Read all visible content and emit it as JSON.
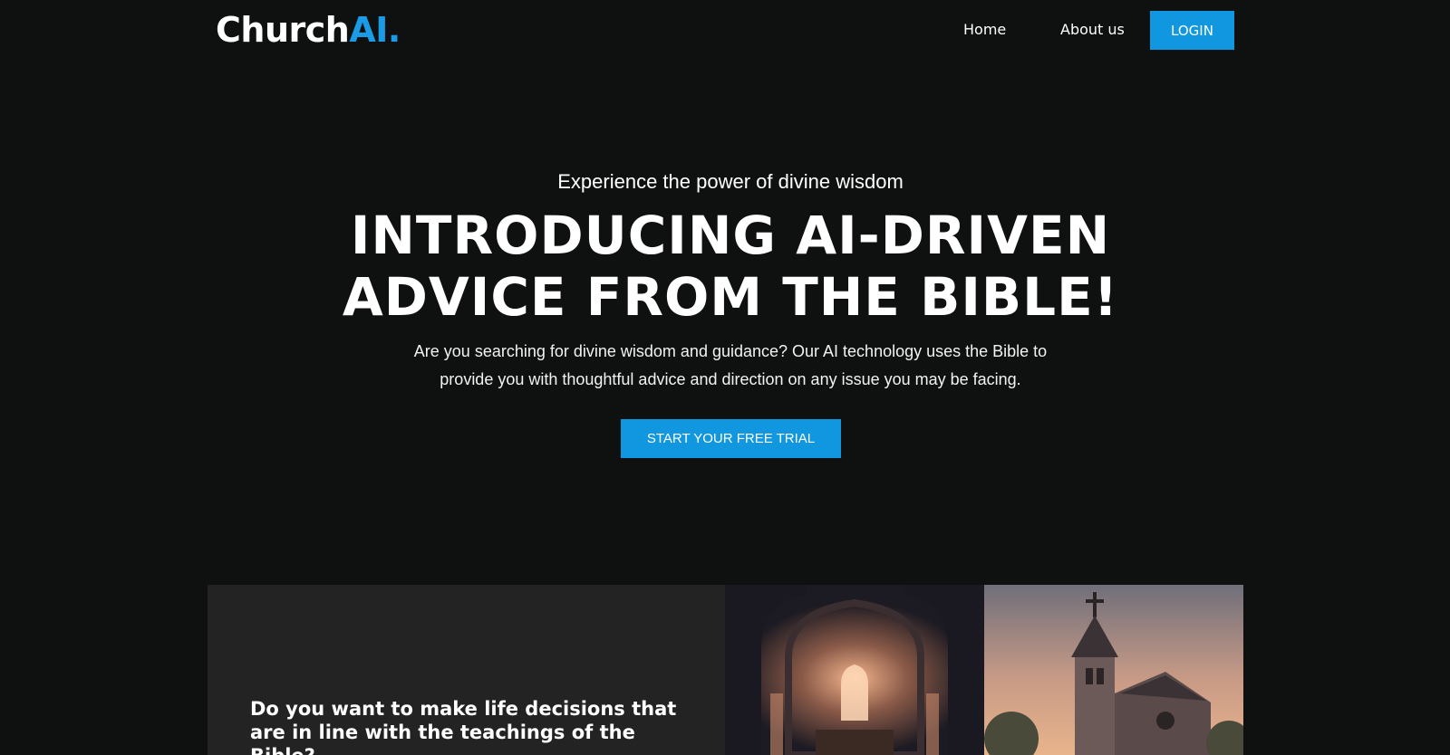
{
  "header": {
    "logo_main": "Church",
    "logo_accent": "AI.",
    "nav": {
      "home": "Home",
      "about": "About us",
      "login": "LOGIN"
    }
  },
  "hero": {
    "eyebrow": "Experience the power of divine wisdom",
    "title": "INTRODUCING AI-DRIVEN ADVICE FROM THE BIBLE!",
    "description": "Are you searching for divine wisdom and guidance? Our AI technology uses the Bible to provide you with thoughtful advice and direction on any issue you may be facing.",
    "cta": "START YOUR FREE TRIAL"
  },
  "feature": {
    "heading": "Do you want to make life decisions that are in line with the teachings of the Bible?"
  },
  "images": [
    {
      "name": "church-interior-image"
    },
    {
      "name": "church-exterior-image"
    }
  ],
  "colors": {
    "background": "#0f1111",
    "accent": "#1196e0",
    "panel": "#232324"
  }
}
